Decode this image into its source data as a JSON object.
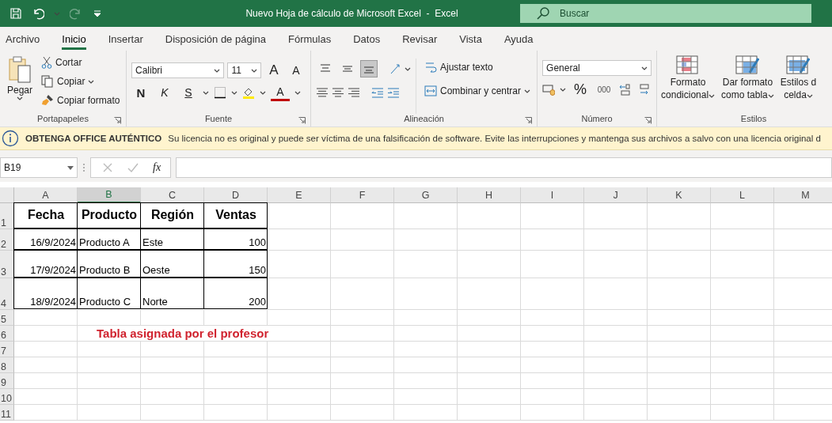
{
  "window": {
    "title": "Nuevo Hoja de cálculo de Microsoft Excel  -  Excel",
    "search": {
      "placeholder": "Buscar"
    }
  },
  "tabs": [
    {
      "label": "Archivo",
      "selected": false
    },
    {
      "label": "Inicio",
      "selected": true
    },
    {
      "label": "Insertar",
      "selected": false
    },
    {
      "label": "Disposición de página",
      "selected": false
    },
    {
      "label": "Fórmulas",
      "selected": false
    },
    {
      "label": "Datos",
      "selected": false
    },
    {
      "label": "Revisar",
      "selected": false
    },
    {
      "label": "Vista",
      "selected": false
    },
    {
      "label": "Ayuda",
      "selected": false
    }
  ],
  "ribbon": {
    "clipboard": {
      "label": "Portapapeles",
      "paste": "Pegar",
      "cut": "Cortar",
      "copy": "Copiar",
      "format_painter": "Copiar formato"
    },
    "font": {
      "label": "Fuente",
      "family": "Calibri",
      "size": "11",
      "grow": "A",
      "shrink": "A",
      "bold": "N",
      "italic": "K",
      "underline": "S",
      "font_color": "A"
    },
    "alignment": {
      "label": "Alineación",
      "vertical": [
        {
          "selected": false
        },
        {
          "selected": false
        },
        {
          "selected": true
        }
      ],
      "wrap": "Ajustar texto",
      "merge": "Combinar y centrar"
    },
    "number": {
      "label": "Número",
      "format": "General",
      "percent": "%",
      "thousands": "000"
    },
    "styles": {
      "label": "Estilos",
      "buttons": [
        {
          "lines": [
            "Formato",
            "condicional"
          ],
          "kind": "conditional"
        },
        {
          "lines": [
            "Dar formato",
            "como tabla"
          ],
          "kind": "table"
        },
        {
          "lines": [
            "Estilos d",
            "celda"
          ],
          "kind": "cell"
        }
      ]
    }
  },
  "info_bar": {
    "title": "OBTENGA OFFICE AUTÉNTICO",
    "message": "Su licencia no es original y puede ser víctima de una falsificación de software. Evite las interrupciones y mantenga sus archivos a salvo con una licencia original d"
  },
  "formula_bar": {
    "name_box": "B19",
    "function_label": "fx"
  },
  "sheet": {
    "columns": [
      {
        "label": "A",
        "selected": false
      },
      {
        "label": "B",
        "selected": true
      },
      {
        "label": "C",
        "selected": false
      },
      {
        "label": "D",
        "selected": false
      },
      {
        "label": "E",
        "selected": false
      },
      {
        "label": "F",
        "selected": false
      },
      {
        "label": "G",
        "selected": false
      },
      {
        "label": "H",
        "selected": false
      },
      {
        "label": "I",
        "selected": false
      },
      {
        "label": "J",
        "selected": false
      },
      {
        "label": "K",
        "selected": false
      },
      {
        "label": "L",
        "selected": false
      },
      {
        "label": "M",
        "selected": false
      }
    ],
    "rows": [
      {
        "number": "1",
        "kind": "tall",
        "cells": [
          {
            "text": "Fecha",
            "kind": "heading"
          },
          {
            "text": "Producto",
            "kind": "heading"
          },
          {
            "text": "Región",
            "kind": "heading"
          },
          {
            "text": "Ventas",
            "kind": "heading"
          }
        ]
      },
      {
        "number": "2",
        "kind": "medium",
        "cells": [
          {
            "text": "16/9/2024",
            "kind": "number"
          },
          {
            "text": "Producto A",
            "kind": "text"
          },
          {
            "text": "Este",
            "kind": "text"
          },
          {
            "text": "100",
            "kind": "number"
          }
        ]
      },
      {
        "number": "3",
        "kind": "taller",
        "cells": [
          {
            "text": "17/9/2024",
            "kind": "number"
          },
          {
            "text": "Producto B",
            "kind": "text"
          },
          {
            "text": "Oeste",
            "kind": "text"
          },
          {
            "text": "150",
            "kind": "number"
          }
        ]
      },
      {
        "number": "4",
        "kind": "tallest",
        "cells": [
          {
            "text": "18/9/2024",
            "kind": "number"
          },
          {
            "text": "Producto C",
            "kind": "text"
          },
          {
            "text": "Norte",
            "kind": "text"
          },
          {
            "text": "200",
            "kind": "number"
          }
        ]
      },
      {
        "number": "5",
        "kind": "normal",
        "cells": []
      },
      {
        "number": "6",
        "kind": "normal",
        "cells": [
          {
            "text": "",
            "kind": "blank"
          },
          {
            "text": "Tabla asignada por el profesor",
            "kind": "note"
          }
        ]
      },
      {
        "number": "7",
        "kind": "normal",
        "cells": []
      },
      {
        "number": "8",
        "kind": "normal",
        "cells": []
      },
      {
        "number": "9",
        "kind": "normal",
        "cells": []
      },
      {
        "number": "10",
        "kind": "normal",
        "cells": []
      },
      {
        "number": "11",
        "kind": "normal",
        "cells": []
      }
    ]
  }
}
